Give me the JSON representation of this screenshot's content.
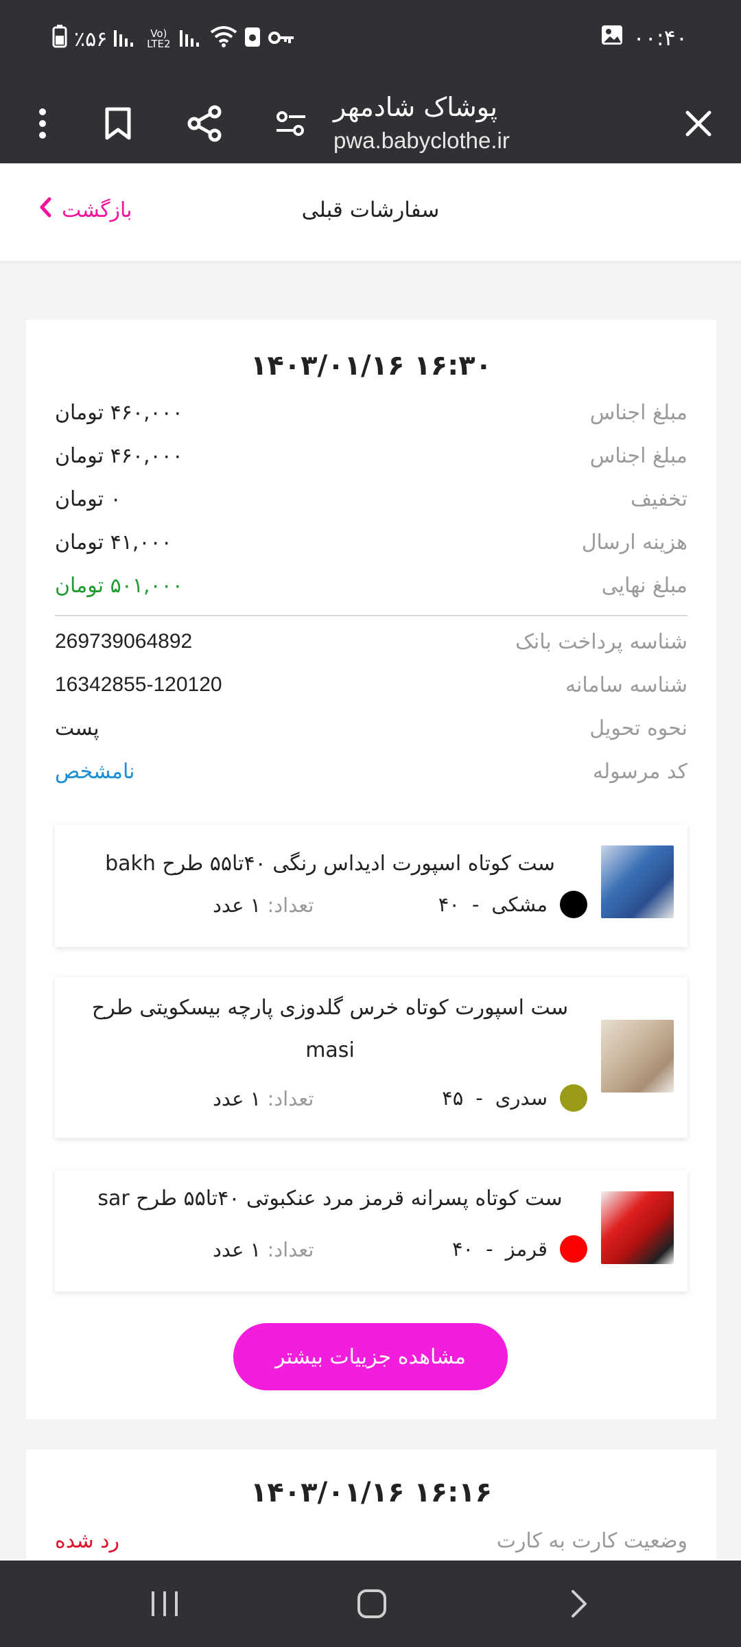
{
  "status_bar": {
    "battery": "٪۵۶",
    "network": "Vo) LTE2",
    "time": "۰۰:۴۰"
  },
  "browser_toolbar": {
    "site_name": "پوشاک شادمهر",
    "site_url": "pwa.babyclothe.ir",
    "icons": [
      "more-vert-icon",
      "bookmark-icon",
      "share-icon",
      "settings-sliders-icon",
      "close-icon"
    ]
  },
  "app_header": {
    "title": "سفارشات قبلی",
    "back_label": "بازگشت",
    "accent": "#f2129b"
  },
  "orders": [
    {
      "datetime": "۱۴۰۳/۰۱/۱۶ ۱۶:۳۰",
      "rows": [
        {
          "label": "مبلغ اجناس",
          "value": "۴۶۰,۰۰۰ تومان"
        },
        {
          "label": "مبلغ اجناس",
          "value": "۴۶۰,۰۰۰ تومان"
        },
        {
          "label": "تخفیف",
          "value": "۰ تومان"
        },
        {
          "label": "هزینه ارسال",
          "value": "۴۱,۰۰۰ تومان"
        },
        {
          "label": "مبلغ نهایی",
          "value": "۵۰۱,۰۰۰ تومان"
        }
      ],
      "payment_rows": [
        {
          "label": "شناسه پرداخت بانک",
          "value": "269739064892"
        },
        {
          "label": "شناسه سامانه",
          "value": "16342855-120120"
        },
        {
          "label": "نحوه تحویل",
          "value": "پست"
        },
        {
          "label": "کد مرسوله",
          "value": "نامشخص"
        }
      ],
      "items": [
        {
          "name": "ست کوتاه اسپورت ادیداس رنگی ۴۰تا۵۵ طرح bakh",
          "color_name": "مشکی",
          "size": "۴۰",
          "color_hex": "#000000",
          "qty_label": "تعداد:",
          "qty_value": "۱ عدد"
        },
        {
          "name": "ست اسپورت کوتاه خرس گلدوزی پارچه بیسکویتی طرح masi",
          "color_name": "سدری",
          "size": "۴۵",
          "color_hex": "#9b9b1a",
          "qty_label": "تعداد:",
          "qty_value": "۱ عدد"
        },
        {
          "name": "ست کوتاه پسرانه قرمز مرد عنکبوتی ۴۰تا۵۵ طرح sar",
          "color_name": "قرمز",
          "size": "۴۰",
          "color_hex": "#ff0000",
          "qty_label": "تعداد:",
          "qty_value": "۱ عدد"
        }
      ],
      "more_button": "مشاهده جزییات بیشتر"
    },
    {
      "datetime": "۱۴۰۳/۰۱/۱۶ ۱۶:۱۶",
      "rows": [
        {
          "label": "وضعیت کارت به کارت",
          "value": "رد شده"
        }
      ]
    }
  ],
  "colors": {
    "final_price": "#1f9a2e",
    "unknown_link": "#1a8fd1",
    "rejected": "#e0102a",
    "button": "#f51ddc"
  },
  "nav_bar": {
    "icons": [
      "recent-apps-icon",
      "home-icon",
      "back-icon"
    ]
  }
}
